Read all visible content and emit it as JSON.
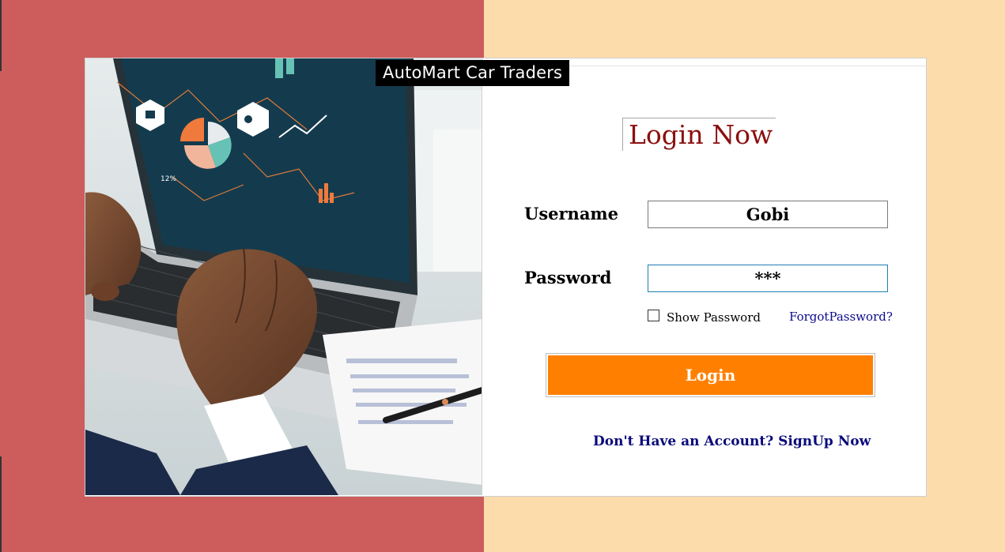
{
  "colors": {
    "left_background": "#cd5c5c",
    "right_background": "#fddcac",
    "title_color": "#8b0f0f",
    "button_color": "#ff8000",
    "link_color": "#0a0a8c"
  },
  "brand": {
    "name": "AutoMart Car Traders"
  },
  "photo": {
    "description_icon": "laptop-analytics-photo",
    "screen_label": "12%"
  },
  "login": {
    "title": "Login Now",
    "username_label": "Username",
    "username_value": "Gobi",
    "password_label": "Password",
    "password_value": "***",
    "show_password_label": "Show Password",
    "show_password_checked": false,
    "forgot_password": "ForgotPassword?",
    "login_button": "Login",
    "signup_link": "Don't Have an Account? SignUp Now"
  }
}
